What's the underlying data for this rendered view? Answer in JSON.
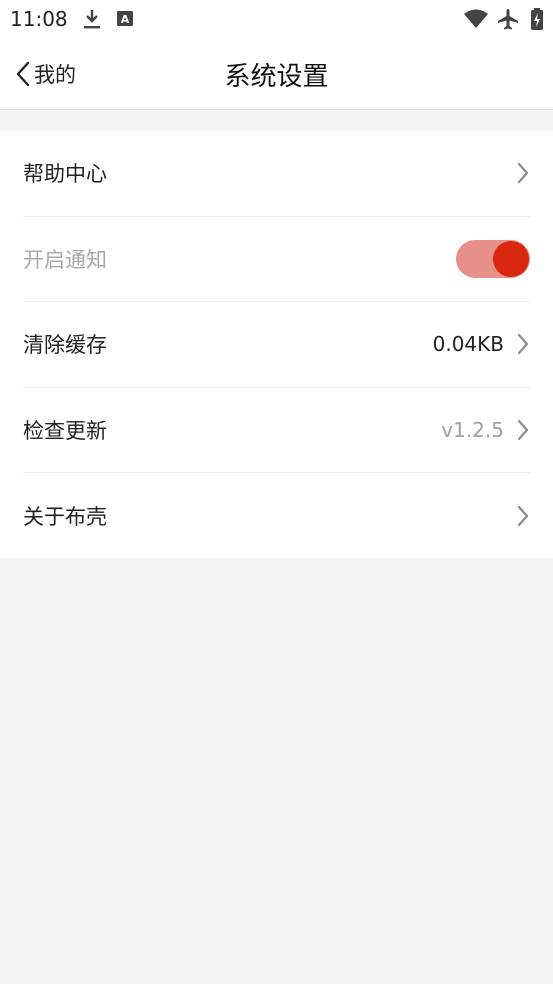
{
  "status_bar": {
    "time": "11:08",
    "left_icons": [
      "download-icon",
      "a-badge-icon"
    ],
    "right_icons": [
      "wifi-icon",
      "airplane-mode-icon",
      "battery-charging-icon"
    ]
  },
  "nav": {
    "back_label": "我的",
    "title": "系统设置"
  },
  "settings": {
    "items": [
      {
        "label": "帮助中心",
        "value": "",
        "chevron": true
      },
      {
        "label": "开启通知",
        "toggle_on": true
      },
      {
        "label": "清除缓存",
        "value": "0.04KB",
        "chevron": true
      },
      {
        "label": "检查更新",
        "value": "v1.2.5",
        "chevron": true
      },
      {
        "label": "关于布壳",
        "value": "",
        "chevron": true
      }
    ]
  },
  "colors": {
    "accent": "#d9260f",
    "toggle_track": "#e8908a",
    "background": "#f4f4f4"
  }
}
